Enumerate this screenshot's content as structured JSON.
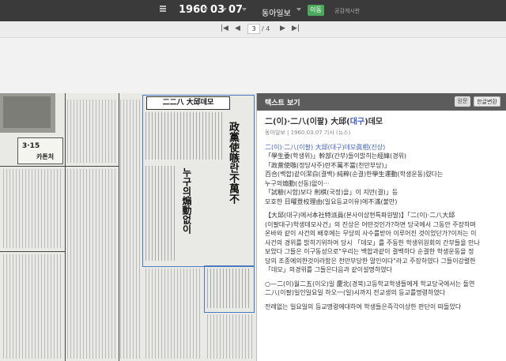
{
  "topbar": {
    "year": "1960",
    "month": "03",
    "day": "07",
    "newspaper": "동아일보",
    "move_label": "이동",
    "shared_label": "공감게시판"
  },
  "pager": {
    "current": "3",
    "separator_total": "/ 4"
  },
  "newspaper_image": {
    "headline": "二二八 大邱데모",
    "side_text_1": "政黨使嗾란不萬不",
    "side_text_2": "누구의煽動없이",
    "badge_315": "3·15",
    "badge_text": "카튼처"
  },
  "panel": {
    "title": "텍스트 보기",
    "btn_original": "원문",
    "btn_convert": "한글변환",
    "article_title_a": "二(이)·二八(이팔) 大邱(",
    "article_title_b": "대구",
    "article_title_c": ")데모",
    "meta": "동아일보 | 1960.03.07 기사 (뉴스)",
    "lines": [
      "二(이)·二八(이팔) 大邱(대구)데모眞相(진상)",
      "「學生委(학생위)」幹部(간부)들이밝히는經緯(경위)",
      "「政黨使嗾(정당사주)란不萬不當(천만부당)」",
      "百合(백합)같이潔白(결백)·純粹(순결)한學生運動(학생운동)렸다는",
      "누구의煽動(선동)없이···",
      "「試驗(시험)보다 劍棋(국정)을」이 지만(결)」등",
      "모호한 日曜登校理由(일요등교이유)에不滿(불만)",
      "【大邱(대구)에서本社特派員(본사이상현특파원발)】「二(이)·二八大邱",
      "(이팔대구)학생데모사건」의 진상은 어떤것인가?하면 당국에서 그동안 주장하며",
      "온바와 같이 사건의 배후에는 무당의 사수를받아 이루어진 것이었단가?이저는 이",
      "사건의 경위를 밝히기위하여 당시 「데모」를 주동한 학생위원회의 간부들을 만나",
      "보았다 그들은 이구동성으로\"우리는 백합과같이 결백하다 순결한 학생운동을 정",
      "당의 조종에의한것이라함은 천만부당한 말인이다\"라고 주장하였다 그들이강렬한",
      "「데모」의경위를 그들은다음과 같이설명하였다",
      "○—二(이)월二五(이오)일 慶北(경북)고등학교학생들에게 학교당국에서는 돌연",
      "二八(이팔)일인일요일 하오一(일)시까지 전교생의 등교를명령하였다",
      "전례없는 일요일의 등교명령에대하여 학생들은즉각이상한 판단이 떠돌았다"
    ]
  }
}
